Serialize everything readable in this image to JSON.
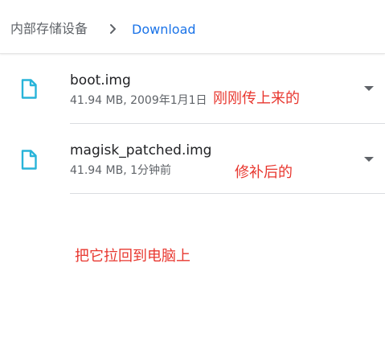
{
  "breadcrumb": {
    "root": "内部存储设备",
    "separator_icon": "chevron-right-icon",
    "current": "Download"
  },
  "files": [
    {
      "name": "boot.img",
      "meta": "41.94 MB, 2009年1月1日",
      "icon": "file-icon",
      "menu_icon": "dropdown-arrow-icon"
    },
    {
      "name": "magisk_patched.img",
      "meta": "41.94 MB, 1分钟前",
      "icon": "file-icon",
      "menu_icon": "dropdown-arrow-icon"
    }
  ],
  "annotations": {
    "boot_note": "刚刚传上来的",
    "patched_note": "修补后的",
    "instruction": "把它拉回到电脑上"
  },
  "colors": {
    "accent": "#1a73e8",
    "icon": "#28b4d9",
    "annotation": "#e8372f"
  }
}
